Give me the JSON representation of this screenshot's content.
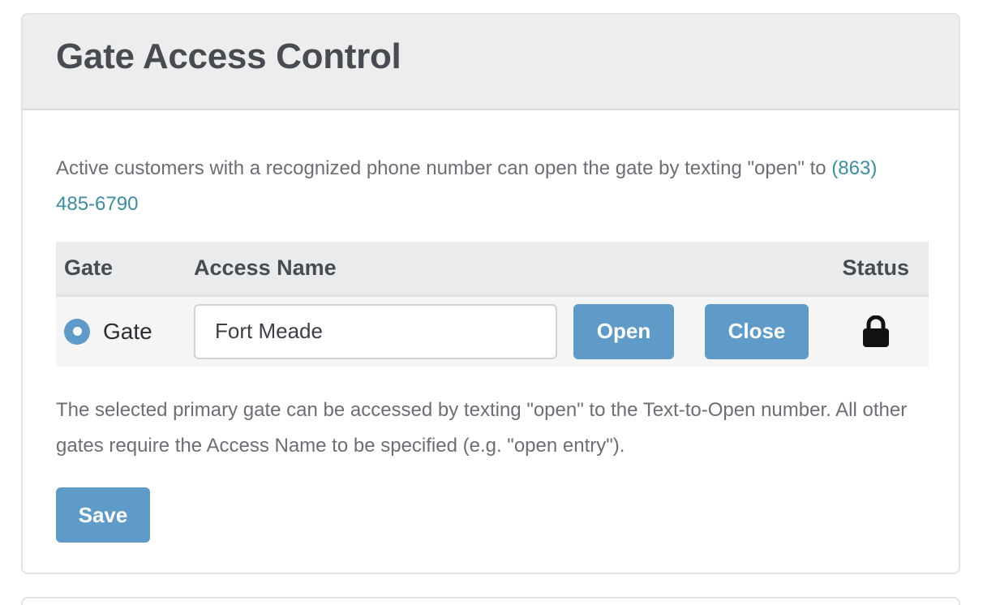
{
  "card": {
    "title": "Gate Access Control",
    "intro_text": "Active customers with a recognized phone number can open the gate by texting \"open\" to ",
    "phone": "(863) 485-6790"
  },
  "table": {
    "headers": {
      "gate": "Gate",
      "access_name": "Access Name",
      "status": "Status"
    },
    "rows": [
      {
        "gate_label": "Gate",
        "selected": true,
        "access_name_value": "Fort Meade",
        "open_label": "Open",
        "close_label": "Close",
        "status_icon": "lock-icon"
      }
    ]
  },
  "footnote": "The selected primary gate can be accessed by texting \"open\" to the Text-to-Open number. All other gates require the Access Name to be specified (e.g. \"open entry\").",
  "save_label": "Save",
  "colors": {
    "accent": "#5f9bc8",
    "link": "#3a8ea0",
    "header_bg": "#ededee",
    "title": "#474b52"
  }
}
